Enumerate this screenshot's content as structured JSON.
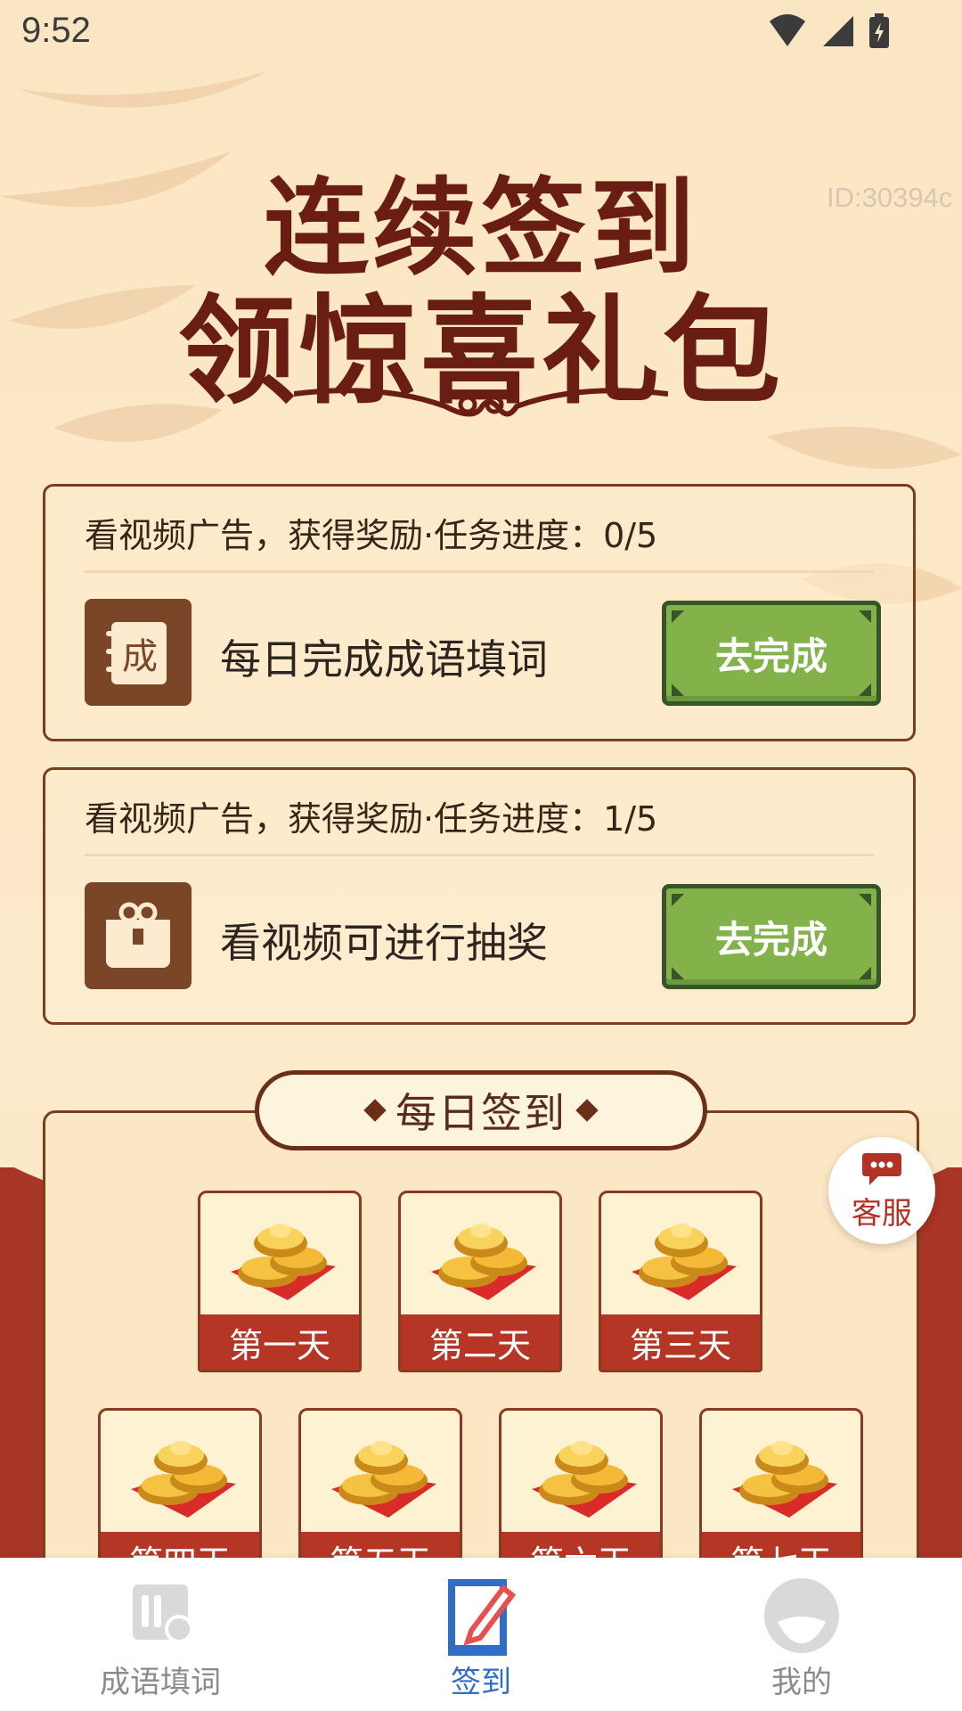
{
  "status_bar": {
    "time": "9:52"
  },
  "id_label": "ID:30394c",
  "headline": {
    "line1": "连续签到",
    "line2": "领惊喜礼包"
  },
  "tasks": [
    {
      "header": "看视频广告，获得奖励·任务进度：0/5",
      "icon": "idiom-book-icon",
      "title": "每日完成成语填词",
      "button": "去完成"
    },
    {
      "header": "看视频广告，获得奖励·任务进度：1/5",
      "icon": "gift-box-icon",
      "title": "看视频可进行抽奖",
      "button": "去完成"
    }
  ],
  "checkin": {
    "title": "每日签到",
    "days": [
      "第一天",
      "第二天",
      "第三天",
      "第四天",
      "第五天",
      "第六天",
      "第七天"
    ]
  },
  "service": {
    "label": "客服"
  },
  "bottom_nav": {
    "items": [
      {
        "label": "成语填词",
        "icon": "book-icon",
        "active": false
      },
      {
        "label": "签到",
        "icon": "edit-icon",
        "active": true
      },
      {
        "label": "我的",
        "icon": "profile-icon",
        "active": false
      }
    ]
  },
  "colors": {
    "headline": "#6a1d12",
    "button_green": "#83b24b",
    "day_label_red": "#b63626",
    "nav_active": "#2f6ec8"
  }
}
